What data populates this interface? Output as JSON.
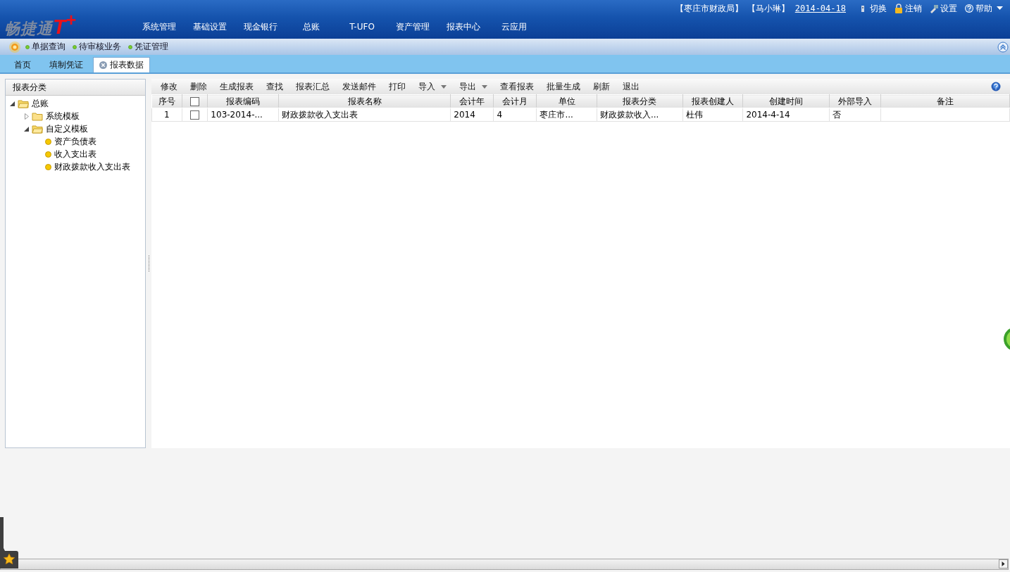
{
  "logo": {
    "name": "畅捷通",
    "mark": "T$^{+}$"
  },
  "user_bar": {
    "org": "【枣庄市财政局】",
    "user": "【马小琳】",
    "date": "2014-04-18",
    "actions": [
      {
        "kind": "switch",
        "label": "切换"
      },
      {
        "kind": "logout",
        "label": "注销"
      },
      {
        "kind": "settings",
        "label": "设置"
      },
      {
        "kind": "help",
        "label": "帮助"
      }
    ]
  },
  "nav": [
    "系统管理",
    "基础设置",
    "现金银行",
    "总账",
    "T-UFO",
    "资产管理",
    "报表中心",
    "云应用"
  ],
  "quick_links": [
    "单据查询",
    "待审核业务",
    "凭证管理"
  ],
  "tabs": [
    {
      "label": "首页",
      "selected": false,
      "closable": false
    },
    {
      "label": "填制凭证",
      "selected": false,
      "closable": false
    },
    {
      "label": "报表数据",
      "selected": true,
      "closable": true
    }
  ],
  "sidebar": {
    "title": "报表分类",
    "tree": [
      {
        "label": "总账",
        "expanded": true,
        "children": [
          {
            "label": "系统模板",
            "expanded": false
          },
          {
            "label": "自定义模板",
            "expanded": true,
            "children": [
              {
                "label": "资产负债表",
                "kind": "leaf"
              },
              {
                "label": "收入支出表",
                "kind": "leaf"
              },
              {
                "label": "财政拨款收入支出表",
                "kind": "leaf"
              }
            ]
          }
        ]
      }
    ]
  },
  "toolbar": [
    {
      "label": "修改",
      "kind": "plain"
    },
    {
      "label": "删除",
      "kind": "plain"
    },
    {
      "label": "生成报表",
      "kind": "plain"
    },
    {
      "label": "查找",
      "kind": "plain"
    },
    {
      "label": "报表汇总",
      "kind": "plain"
    },
    {
      "label": "发送邮件",
      "kind": "plain"
    },
    {
      "label": "打印",
      "kind": "plain"
    },
    {
      "label": "导入",
      "kind": "dropdown"
    },
    {
      "label": "导出",
      "kind": "dropdown"
    },
    {
      "label": "查看报表",
      "kind": "plain"
    },
    {
      "label": "批量生成",
      "kind": "plain"
    },
    {
      "label": "刷新",
      "kind": "plain"
    },
    {
      "label": "退出",
      "kind": "plain"
    }
  ],
  "table": {
    "all_checked": false,
    "columns": [
      {
        "label": "序号",
        "kind": "text"
      },
      {
        "kind": "check"
      },
      {
        "label": "报表编码",
        "kind": "text"
      },
      {
        "label": "报表名称",
        "kind": "text"
      },
      {
        "label": "会计年",
        "kind": "text"
      },
      {
        "label": "会计月",
        "kind": "text"
      },
      {
        "label": "单位",
        "kind": "text"
      },
      {
        "label": "报表分类",
        "kind": "text"
      },
      {
        "label": "报表创建人",
        "kind": "text"
      },
      {
        "label": "创建时间",
        "kind": "text"
      },
      {
        "label": "外部导入",
        "kind": "text"
      },
      {
        "label": "备注",
        "kind": "text"
      }
    ],
    "rows": [
      {
        "checked": false,
        "cells": [
          "1",
          "",
          "103-2014-...",
          "财政拨款收入支出表",
          "2014",
          "4",
          "枣庄市...",
          "财政拨款收入...",
          "杜伟",
          "2014-4-14",
          "否",
          ""
        ]
      }
    ]
  }
}
